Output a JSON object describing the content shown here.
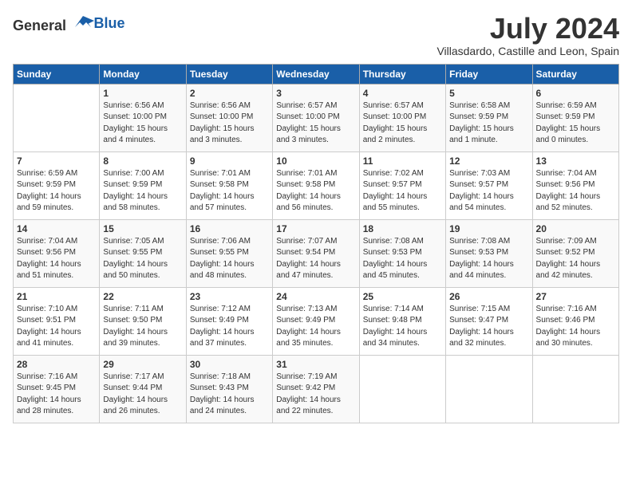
{
  "logo": {
    "text_general": "General",
    "text_blue": "Blue"
  },
  "title": {
    "month": "July 2024",
    "location": "Villasdardo, Castille and Leon, Spain"
  },
  "headers": [
    "Sunday",
    "Monday",
    "Tuesday",
    "Wednesday",
    "Thursday",
    "Friday",
    "Saturday"
  ],
  "weeks": [
    [
      {
        "day": "",
        "sunrise": "",
        "sunset": "",
        "daylight": ""
      },
      {
        "day": "1",
        "sunrise": "Sunrise: 6:56 AM",
        "sunset": "Sunset: 10:00 PM",
        "daylight": "Daylight: 15 hours and 4 minutes."
      },
      {
        "day": "2",
        "sunrise": "Sunrise: 6:56 AM",
        "sunset": "Sunset: 10:00 PM",
        "daylight": "Daylight: 15 hours and 3 minutes."
      },
      {
        "day": "3",
        "sunrise": "Sunrise: 6:57 AM",
        "sunset": "Sunset: 10:00 PM",
        "daylight": "Daylight: 15 hours and 3 minutes."
      },
      {
        "day": "4",
        "sunrise": "Sunrise: 6:57 AM",
        "sunset": "Sunset: 10:00 PM",
        "daylight": "Daylight: 15 hours and 2 minutes."
      },
      {
        "day": "5",
        "sunrise": "Sunrise: 6:58 AM",
        "sunset": "Sunset: 9:59 PM",
        "daylight": "Daylight: 15 hours and 1 minute."
      },
      {
        "day": "6",
        "sunrise": "Sunrise: 6:59 AM",
        "sunset": "Sunset: 9:59 PM",
        "daylight": "Daylight: 15 hours and 0 minutes."
      }
    ],
    [
      {
        "day": "7",
        "sunrise": "Sunrise: 6:59 AM",
        "sunset": "Sunset: 9:59 PM",
        "daylight": "Daylight: 14 hours and 59 minutes."
      },
      {
        "day": "8",
        "sunrise": "Sunrise: 7:00 AM",
        "sunset": "Sunset: 9:59 PM",
        "daylight": "Daylight: 14 hours and 58 minutes."
      },
      {
        "day": "9",
        "sunrise": "Sunrise: 7:01 AM",
        "sunset": "Sunset: 9:58 PM",
        "daylight": "Daylight: 14 hours and 57 minutes."
      },
      {
        "day": "10",
        "sunrise": "Sunrise: 7:01 AM",
        "sunset": "Sunset: 9:58 PM",
        "daylight": "Daylight: 14 hours and 56 minutes."
      },
      {
        "day": "11",
        "sunrise": "Sunrise: 7:02 AM",
        "sunset": "Sunset: 9:57 PM",
        "daylight": "Daylight: 14 hours and 55 minutes."
      },
      {
        "day": "12",
        "sunrise": "Sunrise: 7:03 AM",
        "sunset": "Sunset: 9:57 PM",
        "daylight": "Daylight: 14 hours and 54 minutes."
      },
      {
        "day": "13",
        "sunrise": "Sunrise: 7:04 AM",
        "sunset": "Sunset: 9:56 PM",
        "daylight": "Daylight: 14 hours and 52 minutes."
      }
    ],
    [
      {
        "day": "14",
        "sunrise": "Sunrise: 7:04 AM",
        "sunset": "Sunset: 9:56 PM",
        "daylight": "Daylight: 14 hours and 51 minutes."
      },
      {
        "day": "15",
        "sunrise": "Sunrise: 7:05 AM",
        "sunset": "Sunset: 9:55 PM",
        "daylight": "Daylight: 14 hours and 50 minutes."
      },
      {
        "day": "16",
        "sunrise": "Sunrise: 7:06 AM",
        "sunset": "Sunset: 9:55 PM",
        "daylight": "Daylight: 14 hours and 48 minutes."
      },
      {
        "day": "17",
        "sunrise": "Sunrise: 7:07 AM",
        "sunset": "Sunset: 9:54 PM",
        "daylight": "Daylight: 14 hours and 47 minutes."
      },
      {
        "day": "18",
        "sunrise": "Sunrise: 7:08 AM",
        "sunset": "Sunset: 9:53 PM",
        "daylight": "Daylight: 14 hours and 45 minutes."
      },
      {
        "day": "19",
        "sunrise": "Sunrise: 7:08 AM",
        "sunset": "Sunset: 9:53 PM",
        "daylight": "Daylight: 14 hours and 44 minutes."
      },
      {
        "day": "20",
        "sunrise": "Sunrise: 7:09 AM",
        "sunset": "Sunset: 9:52 PM",
        "daylight": "Daylight: 14 hours and 42 minutes."
      }
    ],
    [
      {
        "day": "21",
        "sunrise": "Sunrise: 7:10 AM",
        "sunset": "Sunset: 9:51 PM",
        "daylight": "Daylight: 14 hours and 41 minutes."
      },
      {
        "day": "22",
        "sunrise": "Sunrise: 7:11 AM",
        "sunset": "Sunset: 9:50 PM",
        "daylight": "Daylight: 14 hours and 39 minutes."
      },
      {
        "day": "23",
        "sunrise": "Sunrise: 7:12 AM",
        "sunset": "Sunset: 9:49 PM",
        "daylight": "Daylight: 14 hours and 37 minutes."
      },
      {
        "day": "24",
        "sunrise": "Sunrise: 7:13 AM",
        "sunset": "Sunset: 9:49 PM",
        "daylight": "Daylight: 14 hours and 35 minutes."
      },
      {
        "day": "25",
        "sunrise": "Sunrise: 7:14 AM",
        "sunset": "Sunset: 9:48 PM",
        "daylight": "Daylight: 14 hours and 34 minutes."
      },
      {
        "day": "26",
        "sunrise": "Sunrise: 7:15 AM",
        "sunset": "Sunset: 9:47 PM",
        "daylight": "Daylight: 14 hours and 32 minutes."
      },
      {
        "day": "27",
        "sunrise": "Sunrise: 7:16 AM",
        "sunset": "Sunset: 9:46 PM",
        "daylight": "Daylight: 14 hours and 30 minutes."
      }
    ],
    [
      {
        "day": "28",
        "sunrise": "Sunrise: 7:16 AM",
        "sunset": "Sunset: 9:45 PM",
        "daylight": "Daylight: 14 hours and 28 minutes."
      },
      {
        "day": "29",
        "sunrise": "Sunrise: 7:17 AM",
        "sunset": "Sunset: 9:44 PM",
        "daylight": "Daylight: 14 hours and 26 minutes."
      },
      {
        "day": "30",
        "sunrise": "Sunrise: 7:18 AM",
        "sunset": "Sunset: 9:43 PM",
        "daylight": "Daylight: 14 hours and 24 minutes."
      },
      {
        "day": "31",
        "sunrise": "Sunrise: 7:19 AM",
        "sunset": "Sunset: 9:42 PM",
        "daylight": "Daylight: 14 hours and 22 minutes."
      },
      {
        "day": "",
        "sunrise": "",
        "sunset": "",
        "daylight": ""
      },
      {
        "day": "",
        "sunrise": "",
        "sunset": "",
        "daylight": ""
      },
      {
        "day": "",
        "sunrise": "",
        "sunset": "",
        "daylight": ""
      }
    ]
  ]
}
